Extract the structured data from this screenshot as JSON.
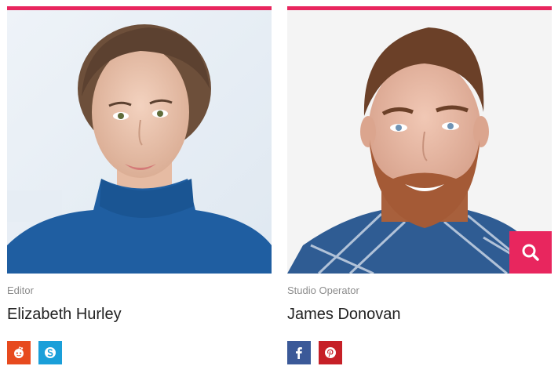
{
  "team": [
    {
      "role": "Editor",
      "name": "Elizabeth Hurley",
      "socials": [
        {
          "icon": "reddit-icon",
          "color": "#e74a1e"
        },
        {
          "icon": "skype-icon",
          "color": "#1a9fd9"
        }
      ]
    },
    {
      "role": "Studio Operator",
      "name": "James Donovan",
      "socials": [
        {
          "icon": "facebook-icon",
          "color": "#3b5998"
        },
        {
          "icon": "pinterest-icon",
          "color": "#c62027"
        }
      ]
    }
  ],
  "colors": {
    "accent": "#e8265e",
    "role_text": "#8c8c8c",
    "name_text": "#222222"
  }
}
